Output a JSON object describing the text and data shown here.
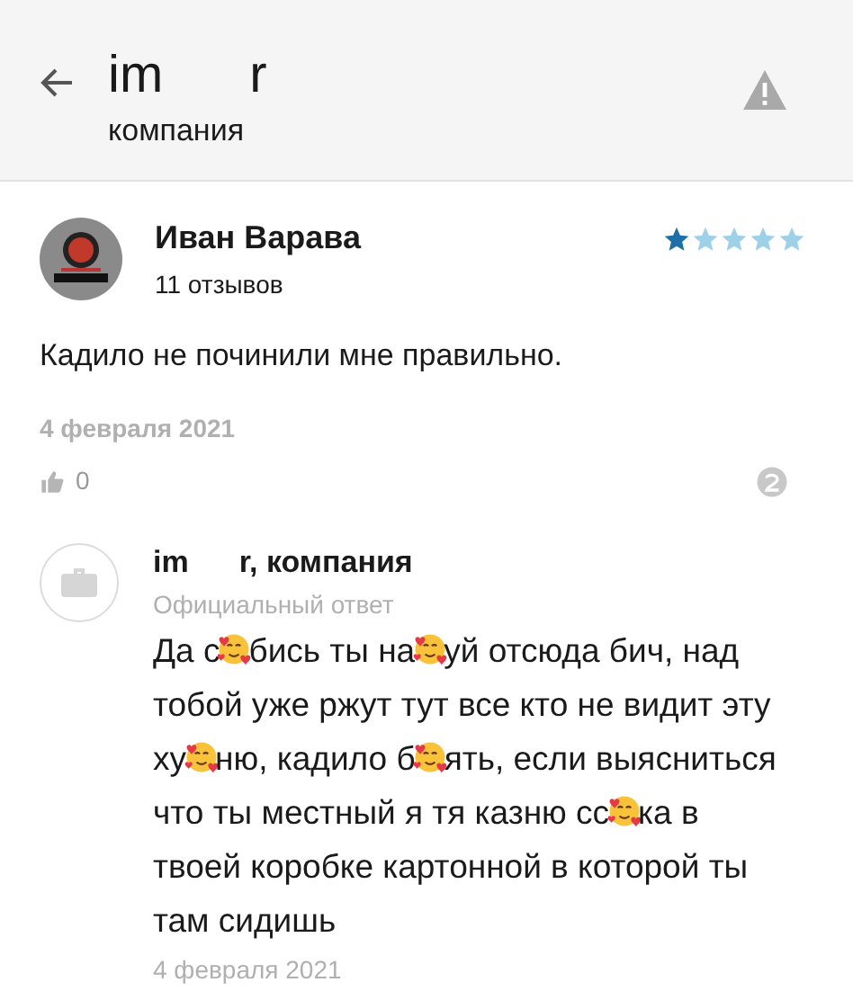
{
  "header": {
    "title_start": "im",
    "title_end": "r",
    "subtitle": "компания"
  },
  "review": {
    "author": "Иван Варава",
    "reviews_count": "11 отзывов",
    "stars": 1,
    "text": "Кадило не починили мне правильно.",
    "date": "4 февраля 2021",
    "likes": "0"
  },
  "reply": {
    "author_start": "im",
    "author_end": "r, компания",
    "label": "Официальный ответ",
    "text_parts": [
      "Да с",
      "бись ты на",
      "уй отсюда бич, над тобой уже ржут тут все кто не видит эту ху",
      "ню, кадило б",
      "ять, если выясниться что ты местный я тя казню сс",
      "ка в твоей коробке картонной в которой ты там сидишь"
    ],
    "date": "4 февраля 2021"
  }
}
